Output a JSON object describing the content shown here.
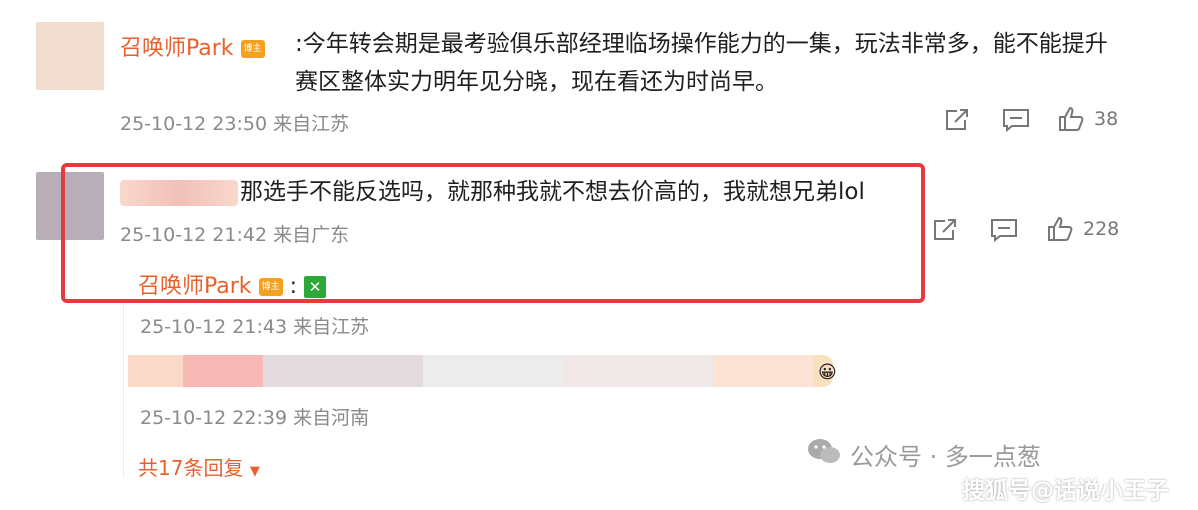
{
  "comments": [
    {
      "author": "召唤师Park",
      "badge": "博主",
      "text": ":今年转会期是最考验俱乐部经理临场操作能力的一集，玩法非常多，能不能提升赛区整体实力明年见分晓，现在看还为时尚早。",
      "meta": "25-10-12 23:50 来自江苏",
      "likes": "38",
      "avatar_color": "#f0ddd0"
    },
    {
      "text": "那选手不能反选吗，就那种我就不想去价高的，我就想兄弟lol",
      "meta": "25-10-12 21:42 来自广东",
      "likes": "228",
      "avatar_color": "#b8aeb8",
      "replies": [
        {
          "author": "召唤师Park",
          "badge": "博主",
          "text": ":",
          "emoji": "✕",
          "meta": "25-10-12 21:43 来自江苏"
        },
        {
          "meta": "25-10-12 22:39 来自河南",
          "emoji": "😀"
        }
      ],
      "more": "共17条回复"
    }
  ],
  "watermarks": {
    "wechat": "公众号 · 多一点葱",
    "sohu": "搜狐号@话说小王子"
  },
  "colors": {
    "accent": "#e8612c",
    "highlight": "#e23b40"
  }
}
